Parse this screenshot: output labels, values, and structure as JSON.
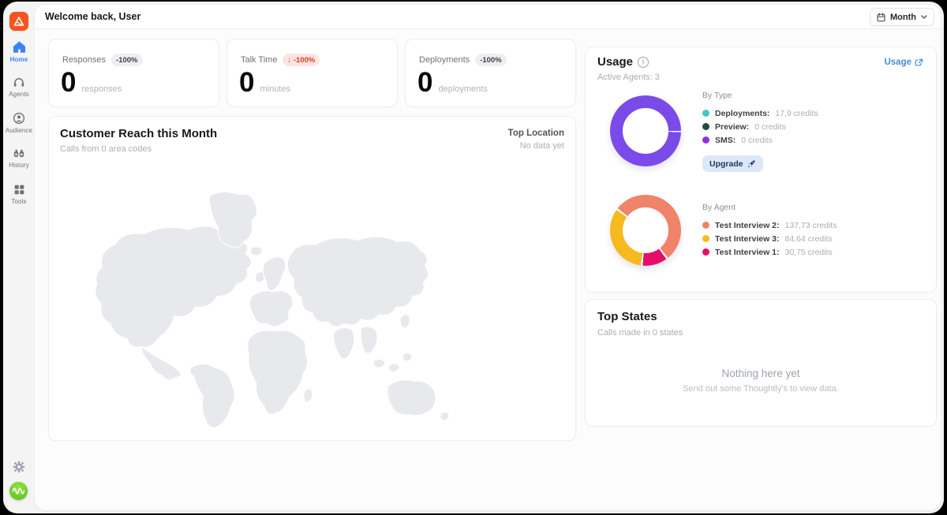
{
  "header": {
    "title": "Welcome back, User",
    "period": {
      "label": "Month"
    }
  },
  "sidebar": {
    "items": [
      {
        "label": "Home",
        "icon": "home-icon",
        "active": true
      },
      {
        "label": "Agents",
        "icon": "headset-icon",
        "active": false
      },
      {
        "label": "Audience",
        "icon": "user-circle-icon",
        "active": false
      },
      {
        "label": "History",
        "icon": "binoculars-icon",
        "active": false
      },
      {
        "label": "Tools",
        "icon": "grid-icon",
        "active": false
      }
    ]
  },
  "stats": [
    {
      "label": "Responses",
      "badge": "-100%",
      "value": "0",
      "unit": "responses"
    },
    {
      "label": "Talk Time",
      "badge": "↓ -100%",
      "value": "0",
      "unit": "minutes"
    },
    {
      "label": "Deployments",
      "badge": "-100%",
      "value": "0",
      "unit": "deployments"
    }
  ],
  "reach": {
    "title": "Customer Reach this Month",
    "subtitle": "Calls from 0 area codes",
    "top_location_label": "Top Location",
    "top_location_value": "No data yet"
  },
  "usage": {
    "title": "Usage",
    "external_link": "Usage",
    "active_agents": "Active Agents: 3",
    "by_type": {
      "heading": "By Type",
      "items": [
        {
          "label": "Deployments:",
          "value": "17,9 credits",
          "color": "#45C8C3"
        },
        {
          "label": "Preview:",
          "value": "0 credits",
          "color": "#1E4D3C"
        },
        {
          "label": "SMS:",
          "value": "0 credits",
          "color": "#8A33DC"
        }
      ]
    },
    "upgrade_label": "Upgrade",
    "by_agent": {
      "heading": "By Agent",
      "items": [
        {
          "label": "Test Interview 2:",
          "value": "137,73 credits",
          "color": "#F0836A"
        },
        {
          "label": "Test Interview 3:",
          "value": "84,64 credits",
          "color": "#F6B91E"
        },
        {
          "label": "Test Interview 1:",
          "value": "30,75 credits",
          "color": "#E60E6B"
        }
      ]
    }
  },
  "top_states": {
    "title": "Top States",
    "subtitle": "Calls made in 0 states",
    "empty_title": "Nothing here yet",
    "empty_subtitle": "Send out some Thoughtly's to view data."
  },
  "chart_data": [
    {
      "type": "donut",
      "title": "By Type",
      "unit": "credits",
      "start_deg": 90,
      "gap_pct": 0.6,
      "segments": [
        {
          "label": "Deployments",
          "value": 17.9,
          "color": "#7A4BE8"
        },
        {
          "label": "Preview",
          "value": 0,
          "color": "#1E4D3C"
        },
        {
          "label": "SMS",
          "value": 0,
          "color": "#8A33DC"
        }
      ]
    },
    {
      "type": "donut",
      "title": "By Agent",
      "unit": "credits",
      "start_deg": -55,
      "gap_pct": 0.9,
      "segments": [
        {
          "label": "Test Interview 2",
          "value": 137.73,
          "color": "#F0836A"
        },
        {
          "label": "Test Interview 1",
          "value": 30.75,
          "color": "#E60E6B"
        },
        {
          "label": "Test Interview 3",
          "value": 84.64,
          "color": "#F6B91E"
        }
      ]
    }
  ]
}
